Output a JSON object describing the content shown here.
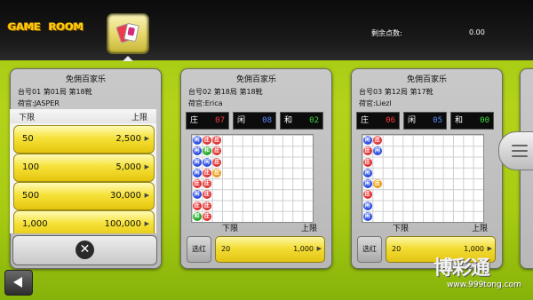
{
  "header": {
    "logo_left": "GAME",
    "logo_right": "ROOM",
    "points_label": "剩余点数:",
    "points_value": "0.00"
  },
  "tables": [
    {
      "name": "免佣百家乐",
      "info": "台号01 第01局 第18靴",
      "dealer": "荷官:JASPER",
      "limit_list": {
        "min_header": "下限",
        "max_header": "上限",
        "rows": [
          {
            "min": "50",
            "max": "2,500"
          },
          {
            "min": "100",
            "max": "5,000"
          },
          {
            "min": "500",
            "max": "30,000"
          },
          {
            "min": "1,000",
            "max": "100,000"
          }
        ]
      }
    },
    {
      "name": "免佣百家乐",
      "info": "台号02 第18局 第18靴",
      "dealer": "荷官:Erica",
      "banker_label": "庄",
      "banker_count": "07",
      "player_label": "闲",
      "player_count": "08",
      "tie_label": "和",
      "tie_count": "02",
      "limit_min_header": "下限",
      "limit_max_header": "上限",
      "select_label": "选红",
      "range_min": "20",
      "range_max": "1,000"
    },
    {
      "name": "免佣百家乐",
      "info": "台号03 第12局 第17靴",
      "dealer": "荷官:Liezl",
      "banker_label": "庄",
      "banker_count": "06",
      "player_label": "闲",
      "player_count": "05",
      "tie_label": "和",
      "tie_count": "00",
      "limit_min_header": "下限",
      "limit_max_header": "上限",
      "select_label": "选红",
      "range_min": "20",
      "range_max": "1,000"
    }
  ],
  "bead_roads": {
    "glyphs": {
      "b": "闲",
      "r": "庄",
      "g": "和",
      "o": "庄"
    },
    "table2": [
      [
        "b",
        "r",
        "r"
      ],
      [
        "b",
        "g",
        "r"
      ],
      [
        "b",
        "b",
        "r"
      ],
      [
        "b",
        "r",
        "o"
      ],
      [
        "r",
        "r",
        ""
      ],
      [
        "b",
        "r",
        ""
      ],
      [
        "r",
        "r",
        ""
      ],
      [
        "g",
        "r",
        ""
      ]
    ],
    "table3": [
      [
        "b",
        "r"
      ],
      [
        "r",
        "b"
      ],
      [
        "r",
        ""
      ],
      [
        "b",
        ""
      ],
      [
        "b",
        "o"
      ],
      [
        "r",
        ""
      ],
      [
        "b",
        ""
      ],
      [
        "b",
        ""
      ]
    ]
  },
  "colors": {
    "banker": "#ff3b3b",
    "player": "#5a8dff",
    "tie": "#3ddc3d"
  },
  "watermark": {
    "logo": "博彩通",
    "url": "www.999tong.com"
  }
}
